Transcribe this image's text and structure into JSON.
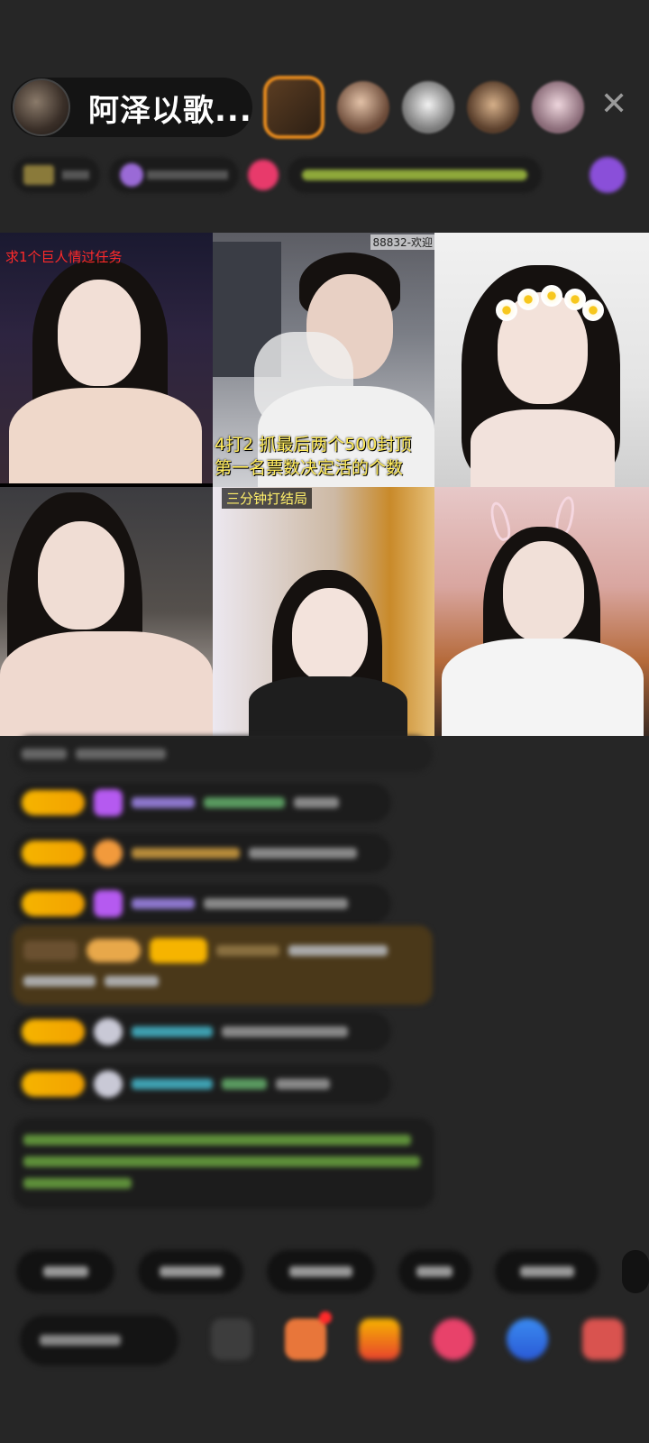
{
  "header": {
    "host_name": "阿泽以歌...",
    "close_icon": "close-icon"
  },
  "tags": {
    "icons": [
      "fan-club-icon",
      "hot-icon",
      "pk-icon",
      "gift-icon"
    ]
  },
  "video_grid": {
    "tile1_overlay": "求1个巨人情过任务",
    "tile2_overlay_top": "88832-欢迎",
    "tile2_caption_line1": "4打2  抓最后两个500封顶",
    "tile2_caption_line2": "第一名票数决定活的个数",
    "tile5_overlay": "三分钟打结局"
  },
  "chat": {
    "messages": []
  },
  "bottom": {
    "input_icon": "chat-input",
    "tool_icons": [
      "emoji-icon",
      "gift-box-icon",
      "gift-icon",
      "heart-icon",
      "share-icon",
      "more-icon"
    ]
  },
  "colors": {
    "background": "#262626",
    "badge_gold": "#f6b400",
    "accent_orange": "#e58a1e",
    "caption_yellow": "#ffeb5a",
    "overlay_red": "#ff2a2a",
    "system_green": "#7ec04c"
  }
}
